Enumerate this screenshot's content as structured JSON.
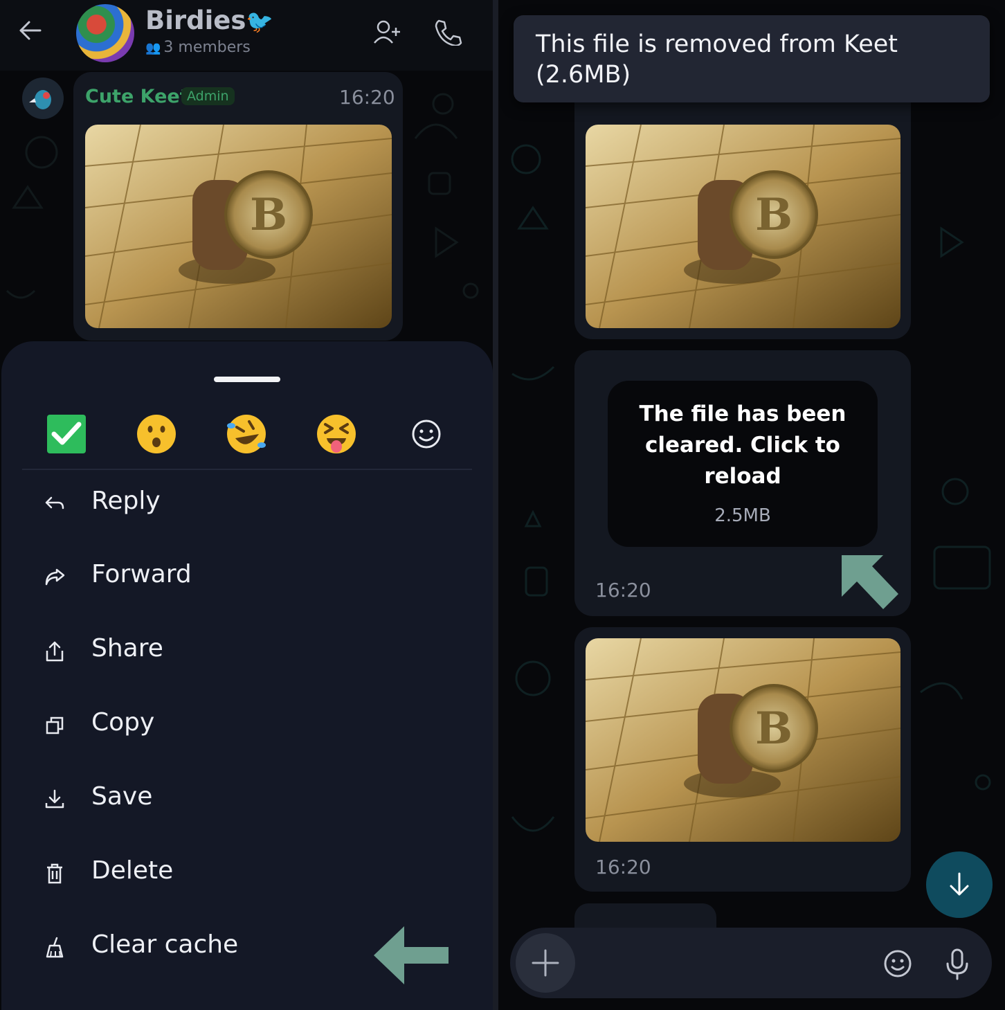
{
  "left": {
    "header": {
      "title": "Birdies",
      "title_emoji": "🐦",
      "members": "3 members",
      "icons": [
        "back-arrow-icon",
        "add-user-icon",
        "phone-icon"
      ]
    },
    "message": {
      "sender": "Cute Keet",
      "role": "Admin",
      "time": "16:20"
    },
    "sheet": {
      "reactions": [
        "✅",
        "😮",
        "🤣",
        "😝"
      ],
      "reaction_picker_icon": "smile-outline-icon",
      "menu": [
        {
          "label": "Reply",
          "icon": "reply-icon"
        },
        {
          "label": "Forward",
          "icon": "forward-icon"
        },
        {
          "label": "Share",
          "icon": "share-icon"
        },
        {
          "label": "Copy",
          "icon": "copy-icon"
        },
        {
          "label": "Save",
          "icon": "save-icon"
        },
        {
          "label": "Delete",
          "icon": "trash-icon"
        },
        {
          "label": "Clear cache",
          "icon": "broom-icon"
        }
      ]
    }
  },
  "right": {
    "toast": {
      "line1": "This file is removed from Keet",
      "line2": "(2.6MB)"
    },
    "cleared_file": {
      "message": "The file has been cleared. Click to reload",
      "size": "2.5MB",
      "time": "16:20"
    },
    "image_message": {
      "time": "16:20"
    },
    "composer": {
      "icons": [
        "plus-icon",
        "emoji-icon",
        "microphone-icon"
      ]
    }
  },
  "colors": {
    "accent_green": "#3da36a",
    "arrow_teal": "#6f9f90",
    "fab_teal": "#0f4b5e"
  }
}
